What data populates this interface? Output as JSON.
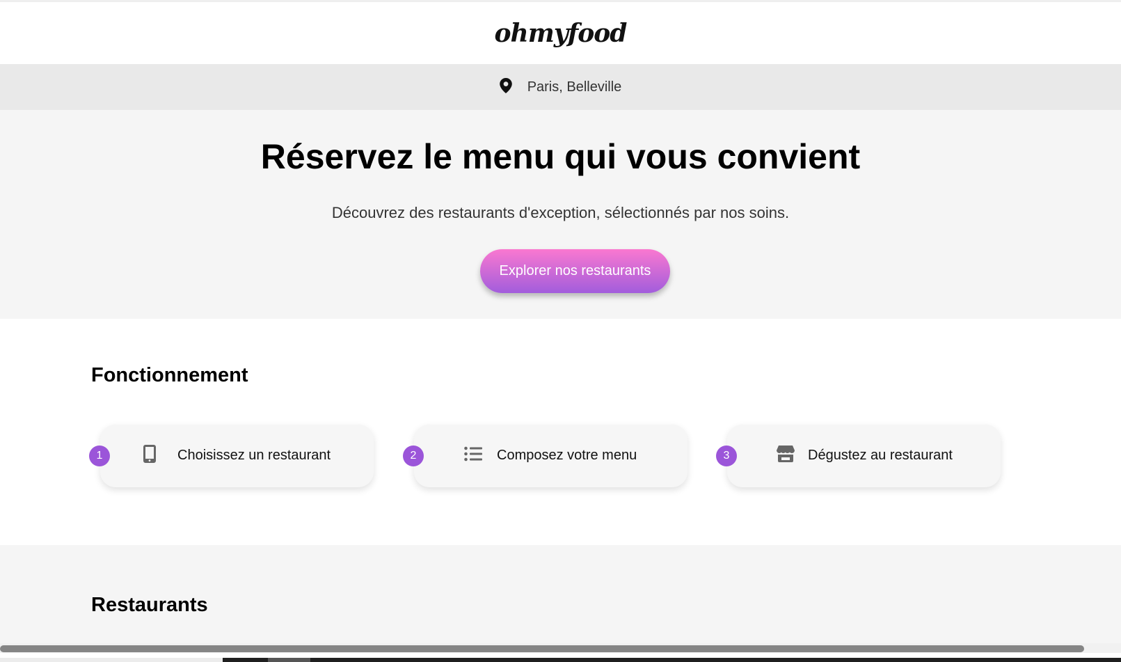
{
  "header": {
    "logo": "ohmyfood"
  },
  "location": {
    "icon": "map-pin-icon",
    "text": "Paris, Belleville"
  },
  "hero": {
    "title": "Réservez le menu qui vous convient",
    "subtitle": "Découvrez des restaurants d'exception, sélectionnés par nos soins.",
    "cta_label": "Explorer nos restaurants",
    "cta_gradient": [
      "#fa78d0",
      "#a25ddc"
    ]
  },
  "how": {
    "title": "Fonctionnement",
    "steps": [
      {
        "number": "1",
        "icon": "smartphone-icon",
        "label": "Choisissez un restaurant"
      },
      {
        "number": "2",
        "icon": "list-icon",
        "label": "Composez votre menu"
      },
      {
        "number": "3",
        "icon": "store-icon",
        "label": "Dégustez au restaurant"
      }
    ],
    "badge_color": "#9b55d9"
  },
  "restaurants": {
    "title": "Restaurants"
  }
}
